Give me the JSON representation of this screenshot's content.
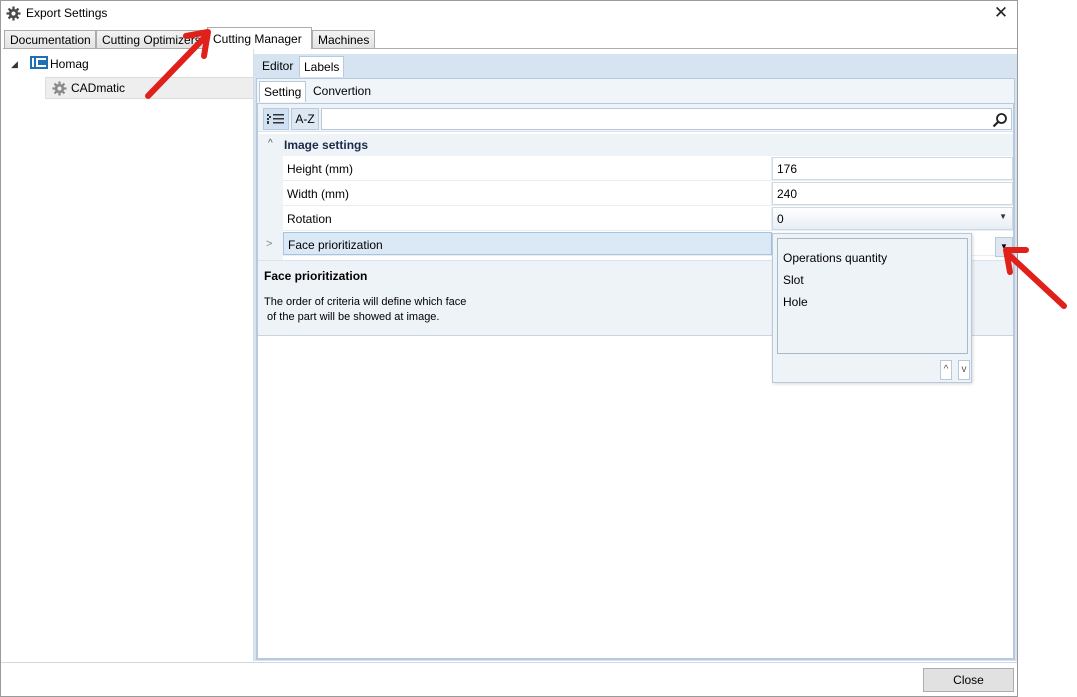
{
  "window": {
    "title": "Export Settings",
    "icon": "gear-icon",
    "close_icon": "close-icon",
    "close_glyph": "✕"
  },
  "main_tabs": [
    "Documentation",
    "Cutting Optimizers",
    "Cutting Manager",
    "Machines"
  ],
  "active_main_tab": "Cutting Manager",
  "tree": {
    "root": {
      "label": "Homag",
      "icon": "homag-logo-icon",
      "expander": "◢"
    },
    "child": {
      "label": "CADmatic",
      "icon": "gear-icon"
    }
  },
  "editor_tabs": [
    "Editor",
    "Labels"
  ],
  "active_editor_tab": "Labels",
  "settings_tabs": [
    "Setting",
    "Convertion"
  ],
  "active_settings_tab": "Setting",
  "toolbar": {
    "categorized_icon": "categorized-icon",
    "sort_label": "A-Z",
    "search_value": "",
    "search_icon": "search-icon"
  },
  "category": {
    "label": "Image settings",
    "chevron": "^"
  },
  "properties": [
    {
      "name": "Height (mm)",
      "value": "176"
    },
    {
      "name": "Width (mm)",
      "value": "240"
    },
    {
      "name": "Rotation",
      "value": "0"
    },
    {
      "name": "Face prioritization",
      "value": ""
    }
  ],
  "row_expander": ">",
  "dropdown_toggle": "▼",
  "description": {
    "title": "Face prioritization",
    "text": "The order of criteria will define which face\n of the part will be showed at image."
  },
  "dropdown": {
    "items": [
      "Operations quantity",
      "Slot",
      "Hole"
    ],
    "up_label": "^",
    "down_label": "v"
  },
  "footer": {
    "close_label": "Close"
  },
  "colors": {
    "accent_annotation": "#e0201a",
    "panel_bg": "#d6e4f1",
    "selection": "#dbe8f6"
  }
}
